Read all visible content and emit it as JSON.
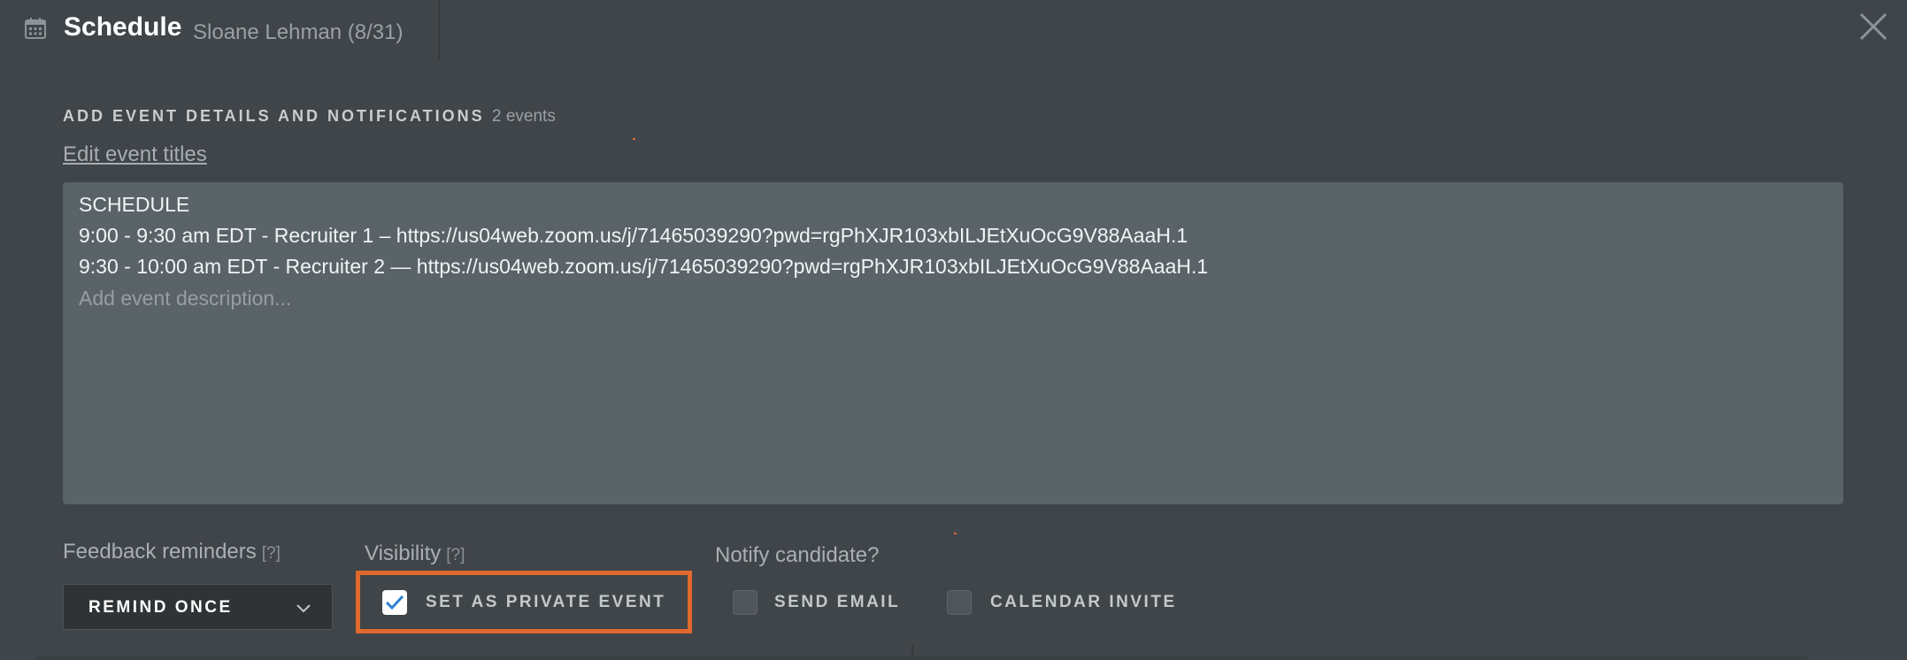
{
  "header": {
    "title": "Schedule",
    "subtitle": "Sloane Lehman (8/31)",
    "calendar_icon": "calendar-icon",
    "close_icon": "close-icon"
  },
  "details": {
    "heading": "ADD EVENT DETAILS AND NOTIFICATIONS",
    "event_count": "2 events",
    "edit_link": "Edit event titles",
    "description_lines": [
      "SCHEDULE",
      "9:00 - 9:30 am EDT -  Recruiter 1 – https://us04web.zoom.us/j/71465039290?pwd=rgPhXJR103xbILJEtXuOcG9V88AaaH.1",
      "9:30 - 10:00 am EDT - Recruiter 2 — https://us04web.zoom.us/j/71465039290?pwd=rgPhXJR103xbILJEtXuOcG9V88AaaH.1"
    ],
    "description_placeholder": "Add event description..."
  },
  "feedback": {
    "label": "Feedback reminders",
    "help": "[?]",
    "selected": "REMIND ONCE"
  },
  "visibility": {
    "label": "Visibility",
    "help": "[?]",
    "private_label": "SET AS PRIVATE EVENT",
    "private_checked": true
  },
  "notify": {
    "label": "Notify candidate?",
    "send_email_label": "SEND EMAIL",
    "send_email_checked": false,
    "calendar_invite_label": "CALENDAR INVITE",
    "calendar_invite_checked": false
  },
  "colors": {
    "highlight": "#e0692e",
    "background": "#404549",
    "textbox": "#5a6468"
  }
}
